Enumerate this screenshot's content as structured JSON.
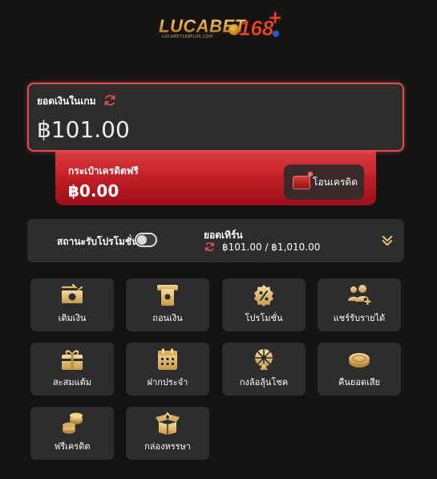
{
  "logo": {
    "brand": "LUCABET",
    "number": "168",
    "plus": "+",
    "sub": "LUCABET168PLUS.COM"
  },
  "balance": {
    "label": "ยอดเงินในเกม",
    "value": "฿101.00"
  },
  "free_credit": {
    "label": "กระเป๋าเครดิตฟรี",
    "value": "฿0.00",
    "transfer_label": "โอนเครดิต"
  },
  "promotion": {
    "label": "สถานะรับโปรโมชั่น",
    "enabled": false
  },
  "turnover": {
    "title": "ยอดเทิร์น",
    "value": "฿101.00 / ฿1,010.00"
  },
  "menu": [
    {
      "label": "เติมเงิน",
      "icon": "deposit-icon"
    },
    {
      "label": "ถอนเงิน",
      "icon": "withdraw-icon"
    },
    {
      "label": "โปรโมชั่น",
      "icon": "promotion-icon"
    },
    {
      "label": "แชร์รับรายได้",
      "icon": "share-income-icon"
    },
    {
      "label": "สะสมแต้ม",
      "icon": "gift-box-icon"
    },
    {
      "label": "ฝากประจำ",
      "icon": "calendar-icon"
    },
    {
      "label": "กงล้อลุ้นโชค",
      "icon": "lucky-wheel-icon"
    },
    {
      "label": "คืนยอดเสีย",
      "icon": "coin-icon"
    },
    {
      "label": "ฟรีเครดิต",
      "icon": "coin-stack-icon"
    },
    {
      "label": "กล่องหรรษา",
      "icon": "open-box-icon"
    }
  ],
  "colors": {
    "background": "#141413",
    "accent_red": "#e34d52",
    "gold": "#e6c37a",
    "card": "#2d2d2d"
  }
}
